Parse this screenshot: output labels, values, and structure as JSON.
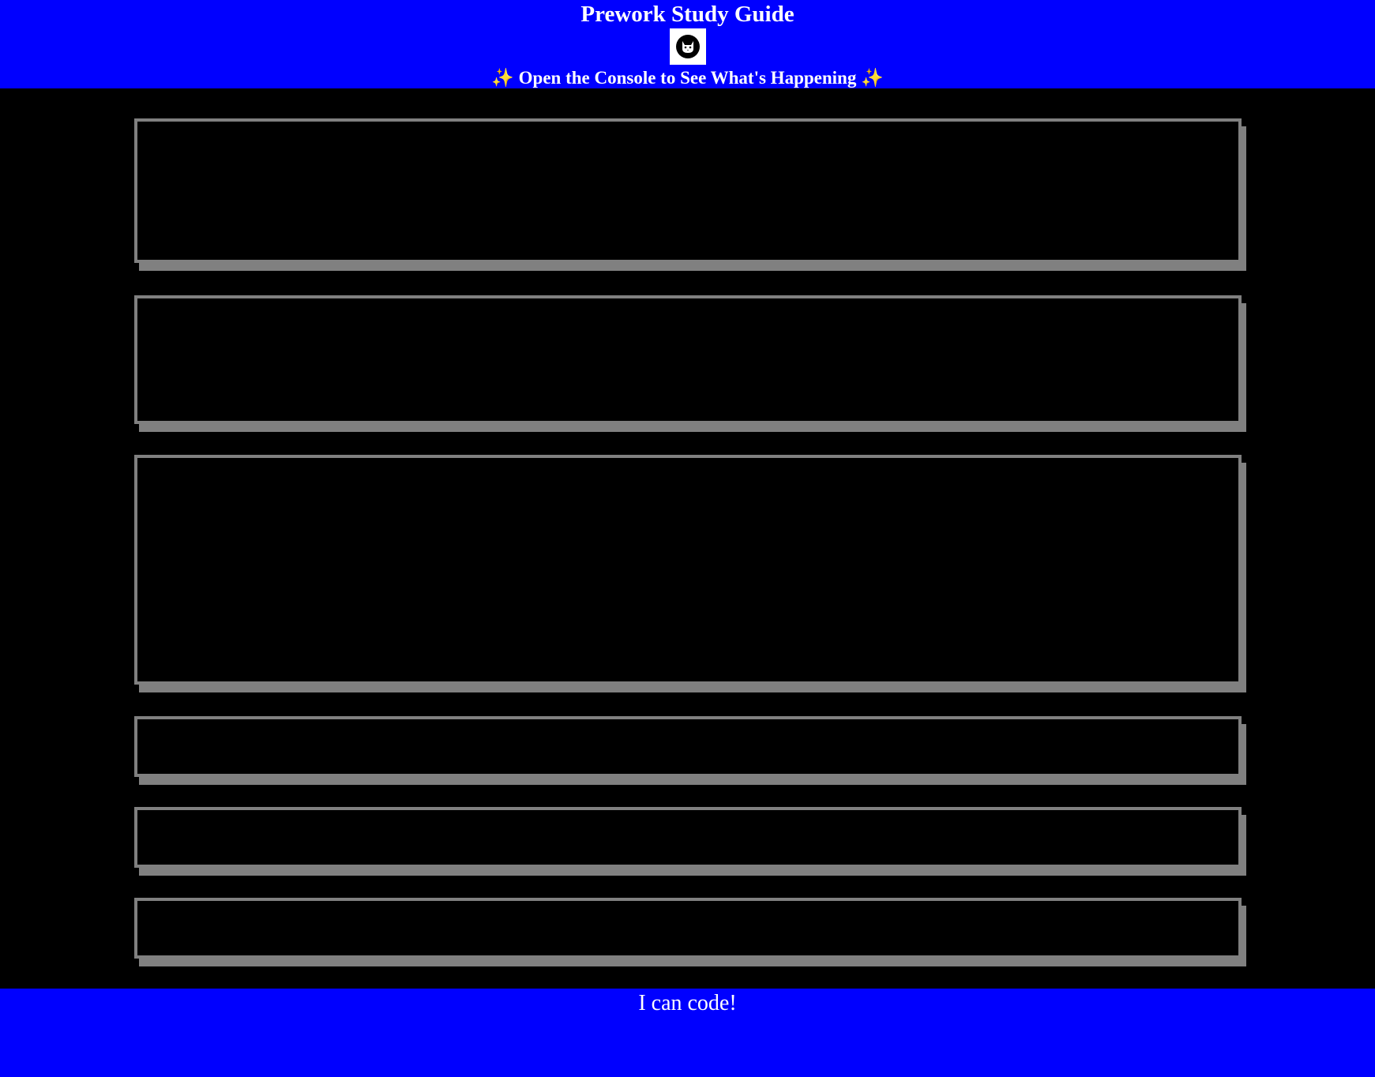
{
  "header": {
    "title": "Prework Study Guide",
    "logo_icon": "cat-icon",
    "subtitle": "Open the Console to See What's Happening",
    "sparkle_left": "✨",
    "sparkle_right": "✨"
  },
  "sections": [
    {
      "name": "section-1"
    },
    {
      "name": "section-2"
    },
    {
      "name": "section-3"
    },
    {
      "name": "section-4"
    },
    {
      "name": "section-5"
    },
    {
      "name": "section-6"
    }
  ],
  "footer": {
    "text": "I can code!"
  },
  "colors": {
    "header_bg": "#0000ff",
    "page_bg": "#000000",
    "border": "#808080",
    "text": "#ffffff"
  }
}
